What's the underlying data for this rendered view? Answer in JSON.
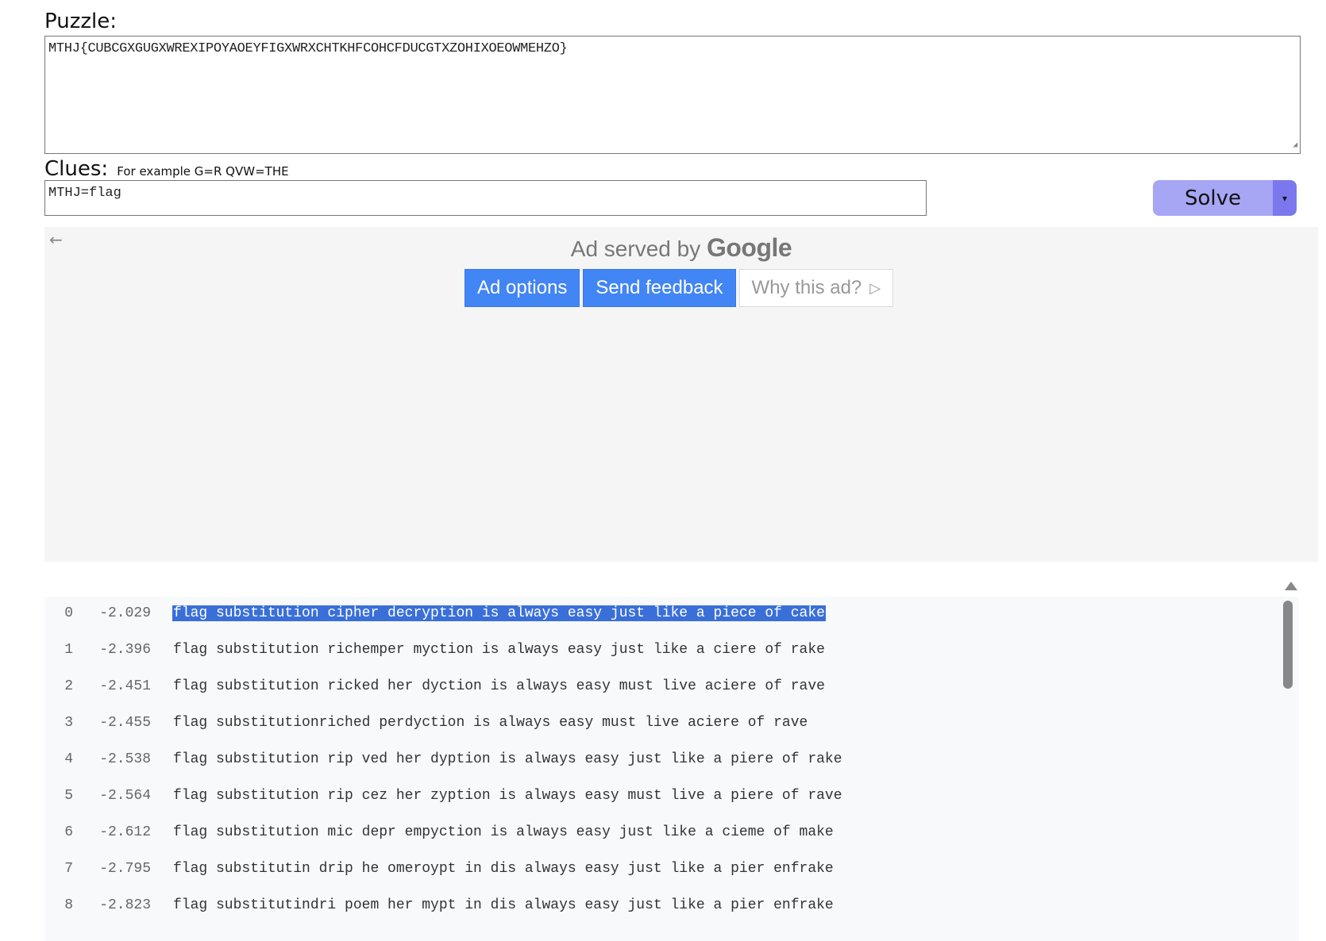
{
  "puzzle": {
    "label": "Puzzle:",
    "text": "MTHJ{CUBCGXGUGXWREXIPOYAOEYFIGXWRXCHTKHFCOHCFDUCGTXZOHIXOEOWMEHZO}"
  },
  "clues": {
    "label": "Clues:",
    "hint": "For example G=R QVW=THE",
    "value": "MTHJ=flag"
  },
  "solve": {
    "label": "Solve",
    "dropdown": "▾"
  },
  "ad": {
    "back_icon": "←",
    "served_by": "Ad served by",
    "google": "Google",
    "options_label": "Ad options",
    "feedback_label": "Send feedback",
    "why_label": "Why this ad?",
    "why_icon": "▷"
  },
  "results": [
    {
      "index": "0",
      "score": "-2.029",
      "text": "flag substitution cipher decryption is always easy just like a piece of cake"
    },
    {
      "index": "1",
      "score": "-2.396",
      "text": "flag substitution richemper myction is always easy just like a ciere of rake"
    },
    {
      "index": "2",
      "score": "-2.451",
      "text": "flag substitution ricked her dyction is always easy must live aciere of rave"
    },
    {
      "index": "3",
      "score": "-2.455",
      "text": "flag substitutionriched perdyction is always easy must live aciere of rave"
    },
    {
      "index": "4",
      "score": "-2.538",
      "text": "flag substitution rip ved her dyption is always easy just like a piere of rake"
    },
    {
      "index": "5",
      "score": "-2.564",
      "text": "flag substitution rip cez her zyption is always easy must live a piere of rave"
    },
    {
      "index": "6",
      "score": "-2.612",
      "text": "flag substitution mic depr empyction is always easy just like a cieme of make"
    },
    {
      "index": "7",
      "score": "-2.795",
      "text": "flag substitutin drip he omeroypt in dis always easy just like a pier enfrake"
    },
    {
      "index": "8",
      "score": "-2.823",
      "text": "flag substitutindri poem her mypt in dis always easy just like a pier enfrake"
    }
  ]
}
